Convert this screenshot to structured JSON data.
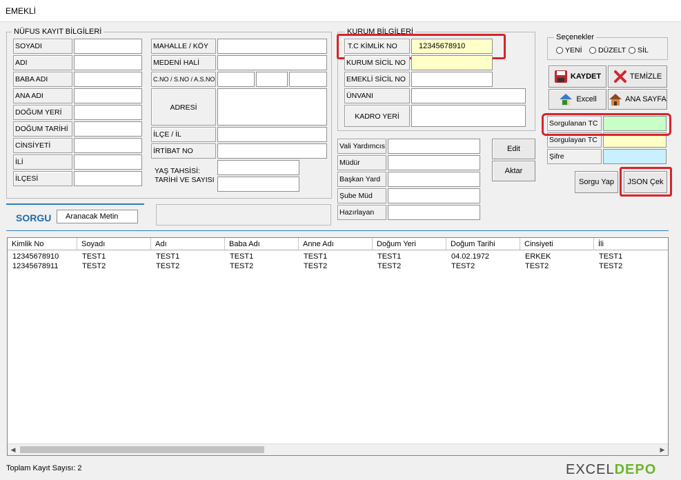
{
  "window": {
    "title": "EMEKLİ"
  },
  "nufus": {
    "legend": "NÜFUS KAYIT BİLGİLERİ",
    "left_labels": [
      "SOYADI",
      "ADI",
      "BABA ADI",
      "ANA ADI",
      "DOĞUM YERİ",
      "DOĞUM TARİHİ",
      "CİNSİYETİ",
      "İLİ",
      "İLÇESİ"
    ],
    "mahalle": "MAHALLE / KÖY",
    "medeni": "MEDENİ HALİ",
    "cno": "C.NO / S.NO / A.S.NO",
    "adres": "ADRESİ",
    "ilce_il": "İLÇE / İL",
    "irtibat": "İRTİBAT NO",
    "yas_line1": "YAŞ TAHSİSİ:",
    "yas_line2": "TARİHİ VE SAYISI"
  },
  "kurum": {
    "legend": "KURUM BİLGİLERİ",
    "tc_label": "T.C KİMLİK  NO",
    "tc_value": "12345678910",
    "sicil": "KURUM SİCİL NO",
    "emekli_sicil": "EMEKLİ SİCİL NO",
    "unvani": "ÜNVANI",
    "kadro": "KADRO YERİ"
  },
  "imza": {
    "labels": [
      "Vali Yardımcısı",
      "Müdür",
      "Başkan Yard",
      "Şube Müd",
      "Hazırlayan"
    ],
    "edit": "Edit",
    "aktar": "Aktar"
  },
  "secenekler": {
    "legend": "Seçenekler",
    "options": [
      "YENİ",
      "DÜZELT",
      "SİL"
    ]
  },
  "buttons": {
    "kaydet": "KAYDET",
    "temizle": "TEMİZLE",
    "excell": "Excell",
    "anasayfa": "ANA SAYFA",
    "sorgu_yap": "Sorgu Yap",
    "json_cek": "JSON Çek"
  },
  "side": {
    "sorgulanan": "Sorgulanan TC",
    "sorgulayan": "Sorgulayan TC",
    "sifre": "Şifre"
  },
  "sorgu": {
    "title": "SORGU",
    "aranacak": "Aranacak Metin"
  },
  "table": {
    "columns": [
      "Kimlik No",
      "Soyadı",
      "Adı",
      "Baba Adı",
      "Anne Adı",
      "Doğum Yeri",
      "Doğum Tarihi",
      "Cinsiyeti",
      "İli"
    ],
    "rows": [
      [
        "12345678910",
        "TEST1",
        "TEST1",
        "TEST1",
        "TEST1",
        "TEST1",
        "04.02.1972",
        "ERKEK",
        "TEST1"
      ],
      [
        "12345678911",
        "TEST2",
        "TEST2",
        "TEST2",
        "TEST2",
        "TEST2",
        "TEST2",
        "TEST2",
        "TEST2"
      ]
    ]
  },
  "status": "Toplam Kayıt Sayısı:  2",
  "logo": {
    "part1": "EXCEL",
    "part2": "DEPO"
  },
  "colors": {
    "accent_blue": "#1f6ca8",
    "highlight_red": "#d8232a",
    "yellow_field": "#ffffc8",
    "green_field": "#c8ffc8",
    "cyan_field": "#c8f0ff"
  }
}
